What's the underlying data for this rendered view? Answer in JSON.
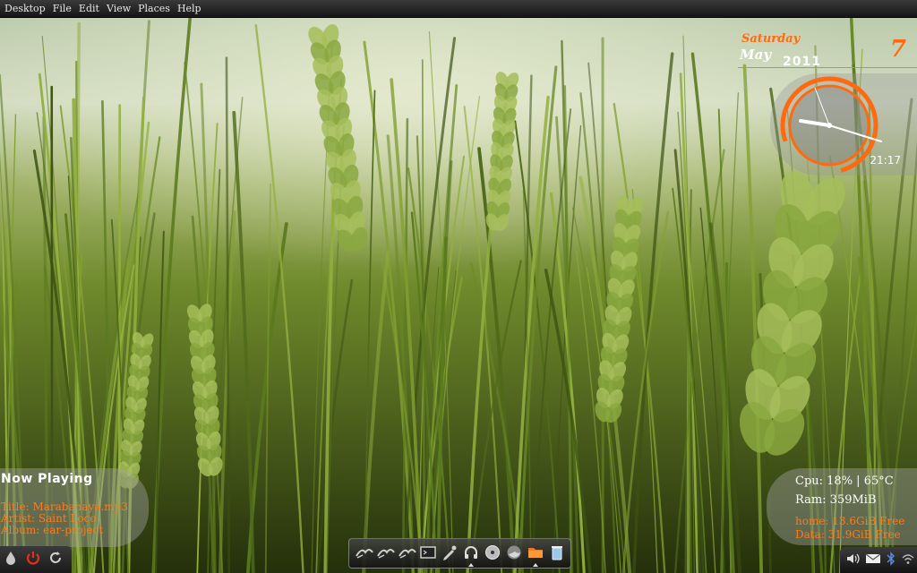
{
  "top_panel": {
    "menus": [
      "Desktop",
      "File",
      "Edit",
      "View",
      "Places",
      "Help"
    ]
  },
  "clock_widget": {
    "day_name": "Saturday",
    "month": "May",
    "year": "2011",
    "day_number": "7",
    "time": "21:17"
  },
  "now_playing": {
    "heading": "Now Playing",
    "title_line": "Title: Marabahaya.mp3",
    "artist_line": "Artist: Saint Loco",
    "album_line": "Album: ear-project"
  },
  "system_monitor": {
    "cpu_line": "Cpu: 18% | 65°C",
    "ram_line": "Ram: 359MiB",
    "home_line": "home: 13.6GiB Free",
    "data_line": "Data: 31.9GiB Free"
  },
  "launcher_icons": [
    "drop-icon",
    "power-icon",
    "refresh-icon"
  ],
  "dock_items": [
    "mailer-icon-1",
    "mailer-icon-2",
    "mailer-icon-3",
    "terminal-icon",
    "pen-icon",
    "headphones-icon",
    "disc-icon",
    "firefox-icon",
    "folder-icon",
    "trash-icon"
  ],
  "tray_icons": [
    "volume-icon",
    "mail-icon",
    "bluetooth-icon",
    "network-icon"
  ],
  "colors": {
    "accent": "#ff6a10",
    "panel": "#1c1c1c"
  }
}
